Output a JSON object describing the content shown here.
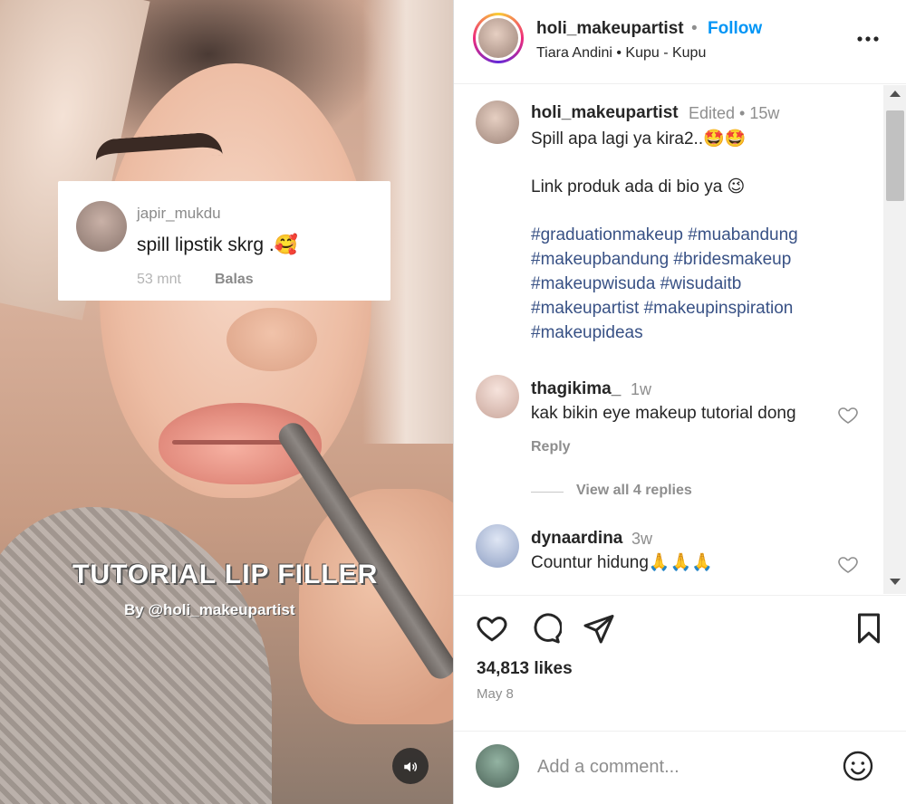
{
  "video": {
    "overlay_comment": {
      "username": "japir_mukdu",
      "text": "spill lipstik skrg .🥰",
      "time": "53 mnt",
      "reply": "Balas"
    },
    "title": "TUTORIAL LIP FILLER",
    "subtitle": "By @holi_makeupartist",
    "sound_icon": "speaker-icon"
  },
  "header": {
    "username": "holi_makeupartist",
    "separator": "•",
    "follow_label": "Follow",
    "subtitle": "Tiara Andini • Kupu - Kupu",
    "more_icon": "more-icon"
  },
  "caption": {
    "username": "holi_makeupartist",
    "meta": "Edited • 15w",
    "line1": "Spill apa lagi ya kira2..🤩🤩",
    "line2": "Link produk ada di bio ya 😉",
    "hashtags": [
      "#graduationmakeup #muabandung",
      "#makeupbandung #bridesmakeup",
      "#makeupwisuda #wisudaitb",
      "#makeupartist #makeupinspiration",
      "#makeupideas"
    ]
  },
  "comments": [
    {
      "username": "thagikima_",
      "time": "1w",
      "text": "kak bikin eye makeup tutorial dong",
      "reply": "Reply",
      "view_replies": "View all 4 replies"
    },
    {
      "username": "dynaardina",
      "time": "3w",
      "text": "Countur hidung🙏🙏🙏"
    }
  ],
  "actions": {
    "like_icon": "heart-icon",
    "comment_icon": "comment-icon",
    "share_icon": "share-icon",
    "save_icon": "bookmark-icon",
    "likes": "34,813 likes",
    "date": "May 8"
  },
  "add_comment": {
    "placeholder": "Add a comment...",
    "emoji_icon": "emoji-icon"
  },
  "colors": {
    "follow": "#0095f6",
    "hashtag": "#385185",
    "muted": "#8e8e8e",
    "text": "#262626"
  }
}
